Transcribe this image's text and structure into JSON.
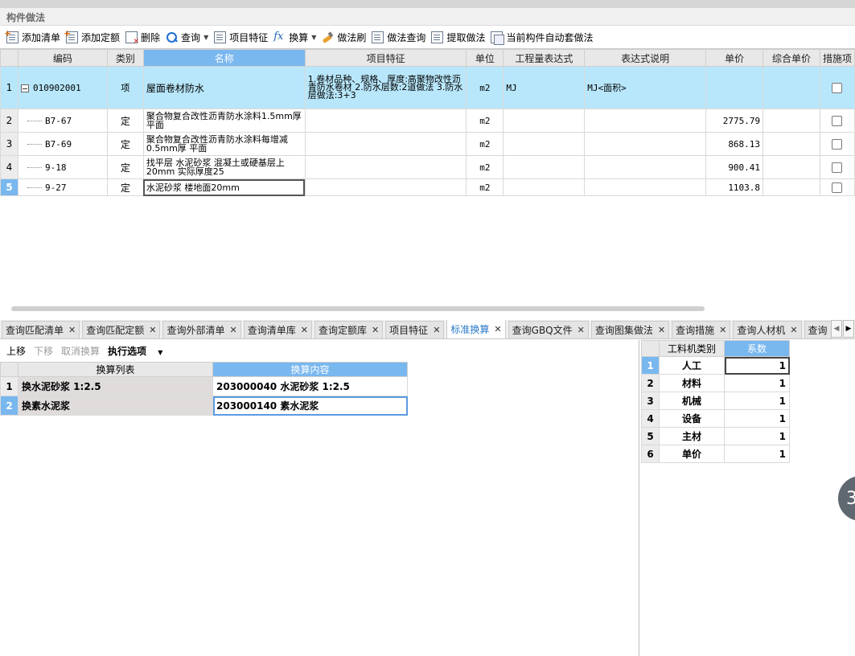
{
  "panel": {
    "title": "构件做法"
  },
  "toolbar": {
    "add_list": "添加清单",
    "add_quota": "添加定额",
    "delete": "删除",
    "query": "查询",
    "features": "项目特征",
    "conversion": "换算",
    "method_brush": "做法刷",
    "method_query": "做法查询",
    "extract": "提取做法",
    "auto_apply": "当前构件自动套做法"
  },
  "grid": {
    "headers": [
      "编码",
      "类别",
      "名称",
      "项目特征",
      "单位",
      "工程量表达式",
      "表达式说明",
      "单价",
      "综合单价",
      "措施项"
    ],
    "rows": [
      {
        "num": "1",
        "code": "010902001",
        "type": "项",
        "name": "屋面卷材防水",
        "feature": "1.卷材品种、规格、厚度:高聚物改性沥青防水卷材 2.防水层数:2道做法 3.防水层做法:3+3",
        "unit": "m2",
        "expr": "MJ",
        "expr_desc": "MJ<面积>",
        "price": "",
        "total": ""
      },
      {
        "num": "2",
        "code": "B7-67",
        "type": "定",
        "name": "聚合物复合改性沥青防水涂料1.5mm厚 平面",
        "feature": "",
        "unit": "m2",
        "expr": "",
        "expr_desc": "",
        "price": "2775.79",
        "total": ""
      },
      {
        "num": "3",
        "code": "B7-69",
        "type": "定",
        "name": "聚合物复合改性沥青防水涂料每增减0.5mm厚 平面",
        "feature": "",
        "unit": "m2",
        "expr": "",
        "expr_desc": "",
        "price": "868.13",
        "total": ""
      },
      {
        "num": "4",
        "code": "9-18",
        "type": "定",
        "name": "找平层 水泥砂浆 混凝土或硬基层上20mm 实际厚度25",
        "feature": "",
        "unit": "m2",
        "expr": "",
        "expr_desc": "",
        "price": "900.41",
        "total": ""
      },
      {
        "num": "5",
        "code": "9-27",
        "type": "定",
        "name": "水泥砂浆 楼地面20mm",
        "feature": "",
        "unit": "m2",
        "expr": "",
        "expr_desc": "",
        "price": "1103.8",
        "total": ""
      }
    ]
  },
  "tabs": [
    {
      "label": "查询匹配清单"
    },
    {
      "label": "查询匹配定额"
    },
    {
      "label": "查询外部清单"
    },
    {
      "label": "查询清单库"
    },
    {
      "label": "查询定额库"
    },
    {
      "label": "项目特征"
    },
    {
      "label": "标准换算"
    },
    {
      "label": "查询GBQ文件"
    },
    {
      "label": "查询图集做法"
    },
    {
      "label": "查询措施"
    },
    {
      "label": "查询人材机"
    },
    {
      "label": "查询"
    }
  ],
  "tab_close": "✕",
  "conversion": {
    "tools": {
      "up": "上移",
      "down": "下移",
      "cancel": "取消换算",
      "options": "执行选项"
    },
    "headers": [
      "换算列表",
      "换算内容"
    ],
    "rows": [
      {
        "num": "1",
        "item": "换水泥砂浆 1:2.5",
        "content": "203000040  水泥砂浆 1:2.5"
      },
      {
        "num": "2",
        "item": "换素水泥浆",
        "content": "203000140  素水泥浆"
      }
    ]
  },
  "coefficients": {
    "headers": [
      "工料机类别",
      "系数"
    ],
    "rows": [
      {
        "num": "1",
        "category": "人工",
        "value": "1"
      },
      {
        "num": "2",
        "category": "材料",
        "value": "1"
      },
      {
        "num": "3",
        "category": "机械",
        "value": "1"
      },
      {
        "num": "4",
        "category": "设备",
        "value": "1"
      },
      {
        "num": "5",
        "category": "主材",
        "value": "1"
      },
      {
        "num": "6",
        "category": "单价",
        "value": "1"
      }
    ]
  },
  "float_button": "3"
}
